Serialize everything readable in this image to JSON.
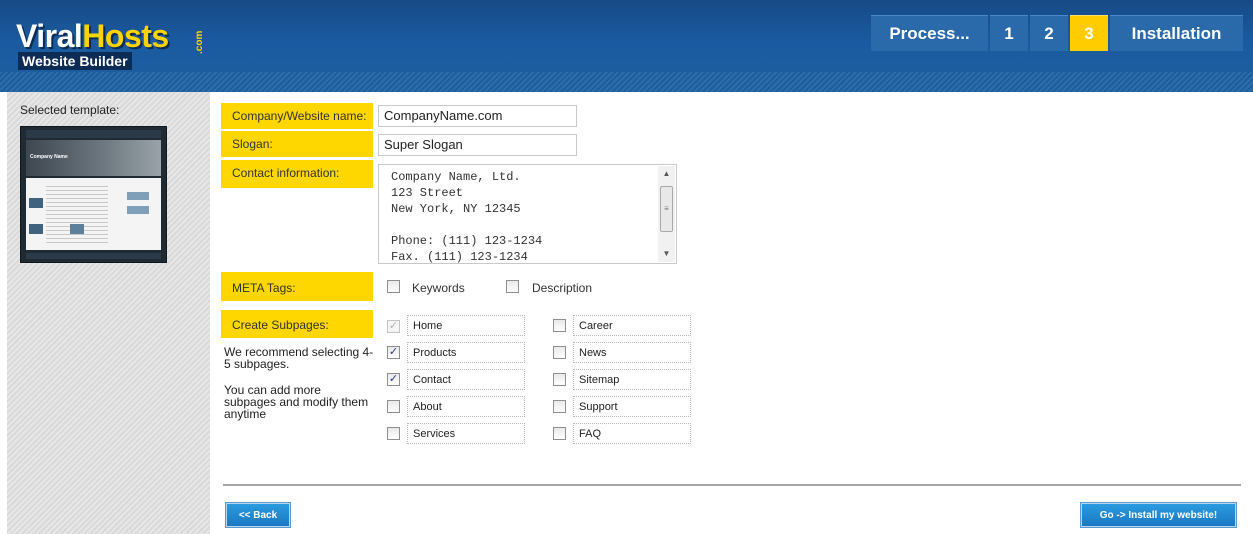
{
  "header": {
    "logo_main_left": "Viral",
    "logo_main_right": "Hosts",
    "logo_suffix": ".com",
    "logo_subtitle": "Website Builder",
    "steps": [
      "Process...",
      "1",
      "2",
      "3",
      "Installation"
    ],
    "active_step": "3"
  },
  "sidebar": {
    "label": "Selected template:",
    "thumb_title": "Company Name"
  },
  "form": {
    "company_label": "Company/Website name:",
    "company_value": "CompanyName.com",
    "slogan_label": "Slogan:",
    "slogan_value": "Super Slogan",
    "contact_label": "Contact information:",
    "contact_lines": [
      "Company Name, Ltd.",
      "123 Street",
      "New York, NY 12345",
      "",
      "Phone: (111) 123-1234",
      "Fax. (111) 123-1234"
    ],
    "meta_label": "META Tags:",
    "meta_options": [
      {
        "label": "Keywords",
        "checked": false
      },
      {
        "label": "Description",
        "checked": false
      }
    ],
    "subpages_label": "Create Subpages:",
    "note_1": "We recommend selecting 4-5 subpages.",
    "note_2": "You can add more subpages and modify them anytime",
    "subpages_left": [
      {
        "name": "Home",
        "checked": true,
        "disabled": true
      },
      {
        "name": "Products",
        "checked": true,
        "disabled": false
      },
      {
        "name": "Contact",
        "checked": true,
        "disabled": false
      },
      {
        "name": "About",
        "checked": false,
        "disabled": false
      },
      {
        "name": "Services",
        "checked": false,
        "disabled": false
      }
    ],
    "subpages_right": [
      {
        "name": "Career",
        "checked": false,
        "disabled": false
      },
      {
        "name": "News",
        "checked": false,
        "disabled": false
      },
      {
        "name": "Sitemap",
        "checked": false,
        "disabled": false
      },
      {
        "name": "Support",
        "checked": false,
        "disabled": false
      },
      {
        "name": "FAQ",
        "checked": false,
        "disabled": false
      }
    ]
  },
  "buttons": {
    "back": "<< Back",
    "install": "Go -> Install my website!"
  },
  "colors": {
    "header_blue": "#1a5aa0",
    "accent_yellow": "#ffd700",
    "button_blue": "#1f86d0"
  },
  "icons": {
    "scroll_up": "▲",
    "scroll_down": "▼",
    "scroll_grip": "≡",
    "check": "✓"
  }
}
